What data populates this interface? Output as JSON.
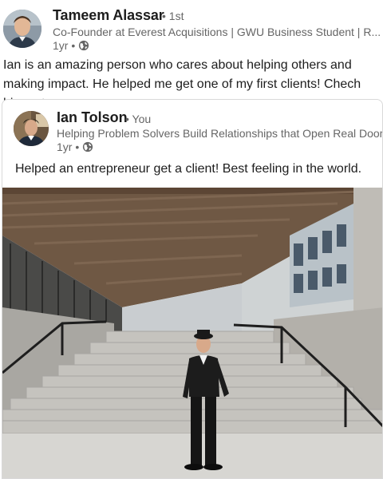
{
  "post": {
    "author": {
      "name": "Tameem Alassar",
      "degree": "• 1st",
      "headline": "Co-Founder at Everest Acquisitions | GWU Business Student | R...",
      "time": "1yr •",
      "visibility_icon": "globe-icon"
    },
    "text": "Ian is an amazing person who cares about helping others and making impact. He helped me get one of my first clients! Chech him out"
  },
  "repost": {
    "author": {
      "name": "Ian Tolson",
      "you_tag": "• You",
      "headline": "Helping Problem Solvers Build Relationships that Open Real Doors...",
      "time": "1yr •",
      "visibility_icon": "globe-icon"
    },
    "text": "Helped an entrepreneur get a client! Best feeling in the world."
  },
  "colors": {
    "text_primary": "#1d1d1d",
    "text_secondary": "#666666",
    "card_border": "#d9d9d9"
  }
}
